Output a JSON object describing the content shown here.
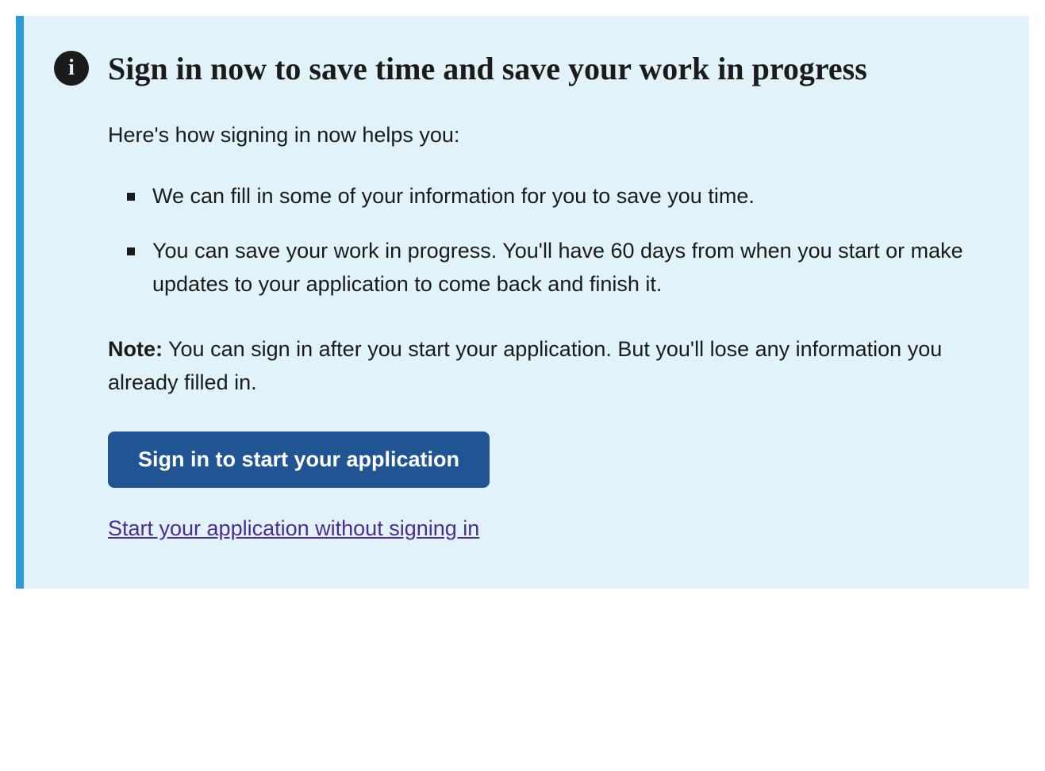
{
  "alert": {
    "title": "Sign in now to save time and save your work in progress",
    "intro": "Here's how signing in now helps you:",
    "benefits": [
      "We can fill in some of your information for you to save you time.",
      "You can save your work in progress. You'll have 60 days from when you start or make updates to your application to come back and finish it."
    ],
    "note_label": "Note:",
    "note_text": " You can sign in after you start your application. But you'll lose any information you already filled in.",
    "primary_button": "Sign in to start your application",
    "secondary_link": "Start your application without signing in"
  }
}
